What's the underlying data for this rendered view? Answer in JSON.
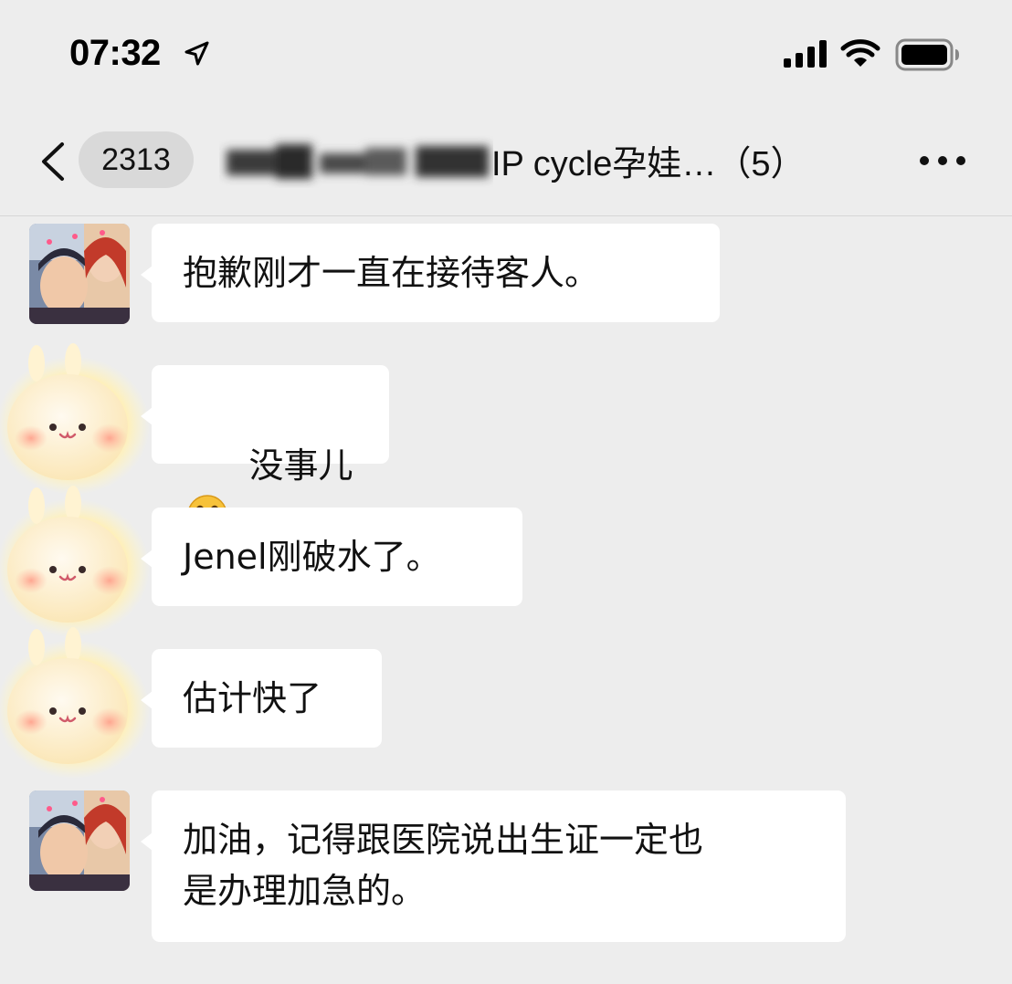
{
  "status_bar": {
    "time": "07:32",
    "icons": [
      "location-arrow-icon",
      "cellular-signal-icon",
      "wifi-icon",
      "battery-icon"
    ]
  },
  "nav": {
    "back_icon": "chevron-left-icon",
    "unread_count": "2313",
    "title": "IP cycle孕娃…（5）",
    "more_icon": "ellipsis-icon"
  },
  "colors": {
    "background": "#ededed",
    "bubble": "#ffffff",
    "badge": "#d9d9d9"
  },
  "messages": [
    {
      "sender": "photo-avatar",
      "text": "抱歉刚才一直在接待客人。"
    },
    {
      "sender": "bunny-avatar",
      "text": "没事儿",
      "emoji": "grinning-face-emoji"
    },
    {
      "sender": "bunny-avatar",
      "text": "Jenel刚破水了。"
    },
    {
      "sender": "bunny-avatar",
      "text": "估计快了"
    },
    {
      "sender": "photo-avatar",
      "text": "加油，记得跟医院说出生证一定也\n是办理加急的。"
    }
  ]
}
